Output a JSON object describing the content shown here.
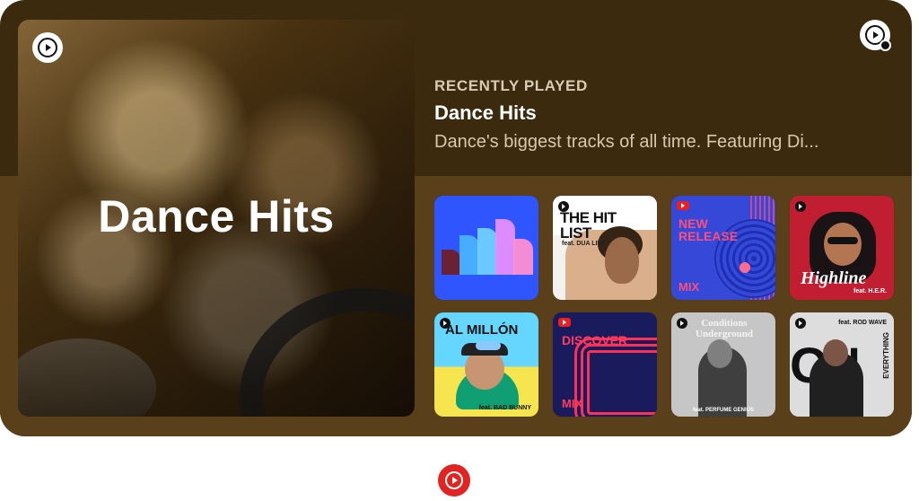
{
  "widget": {
    "hero_title": "Dance Hits",
    "eyebrow": "RECENTLY PLAYED",
    "title": "Dance Hits",
    "description": "Dance's biggest tracks of all time. Featuring Di..."
  },
  "tiles": [
    {
      "name": "playlist-tile-colorful-bars"
    },
    {
      "name": "playlist-tile-hit-list",
      "title": "THE HIT LIST",
      "feat": "feat. DUA LIPA"
    },
    {
      "name": "playlist-tile-new-release-mix",
      "title": "NEW RELEASE",
      "mix": "MIX"
    },
    {
      "name": "playlist-tile-highline",
      "title": "Highline",
      "feat": "feat. H.E.R."
    },
    {
      "name": "playlist-tile-al-millon",
      "title": "AL MILLÓN",
      "feat": "feat. BAD BUNNY"
    },
    {
      "name": "playlist-tile-discover-mix",
      "title": "DISCOVER",
      "mix": "MIX"
    },
    {
      "name": "playlist-tile-conditions-underground",
      "title": "Conditions Underground",
      "feat": "feat. PERFUME GENIUS"
    },
    {
      "name": "playlist-tile-on-everything",
      "title": "ON",
      "side": "EVERYTHING",
      "feat": "feat. ROD WAVE"
    }
  ],
  "icons": {
    "hero_logo": "youtube-music-icon",
    "corner_logo": "youtube-music-icon",
    "bottom_logo": "youtube-music-icon"
  },
  "colors": {
    "widget_top": "#3b2a0d",
    "widget_bottom": "#5a3f1b",
    "accent_red": "#e32222"
  }
}
